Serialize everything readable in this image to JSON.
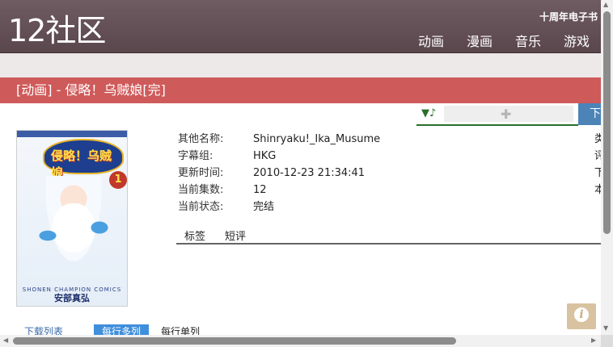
{
  "header": {
    "logo": "12社区",
    "anniversary": "十周年电子书",
    "nav": [
      "动画",
      "漫画",
      "音乐",
      "游戏"
    ]
  },
  "title_bar": "[动画] - 侵略！乌贼娘[完]",
  "toolbar": {
    "download_label": "下"
  },
  "cover": {
    "title_text": "侵略！乌贼娘",
    "volume": "1",
    "publisher": "SHONEN CHAMPION COMICS",
    "author": "安部真弘"
  },
  "info": [
    {
      "label": "其他名称:",
      "value": "Shinryaku!_Ika_Musume"
    },
    {
      "label": "字幕组:",
      "value": "HKG"
    },
    {
      "label": "更新时间:",
      "value": "2010-12-23 21:34:41"
    },
    {
      "label": "当前集数:",
      "value": "12"
    },
    {
      "label": "当前状态:",
      "value": "完结"
    }
  ],
  "right_cut": [
    "类",
    "评",
    "下",
    "本"
  ],
  "tabs": [
    "标签",
    "短评"
  ],
  "list_bar": {
    "title": "下载列表",
    "mode_multi": "每行多列",
    "mode_single": "每行单列"
  },
  "colors": {
    "header": "#5f4b52",
    "title_bar": "#cf5a5a",
    "accent_blue": "#3f8fdc"
  }
}
